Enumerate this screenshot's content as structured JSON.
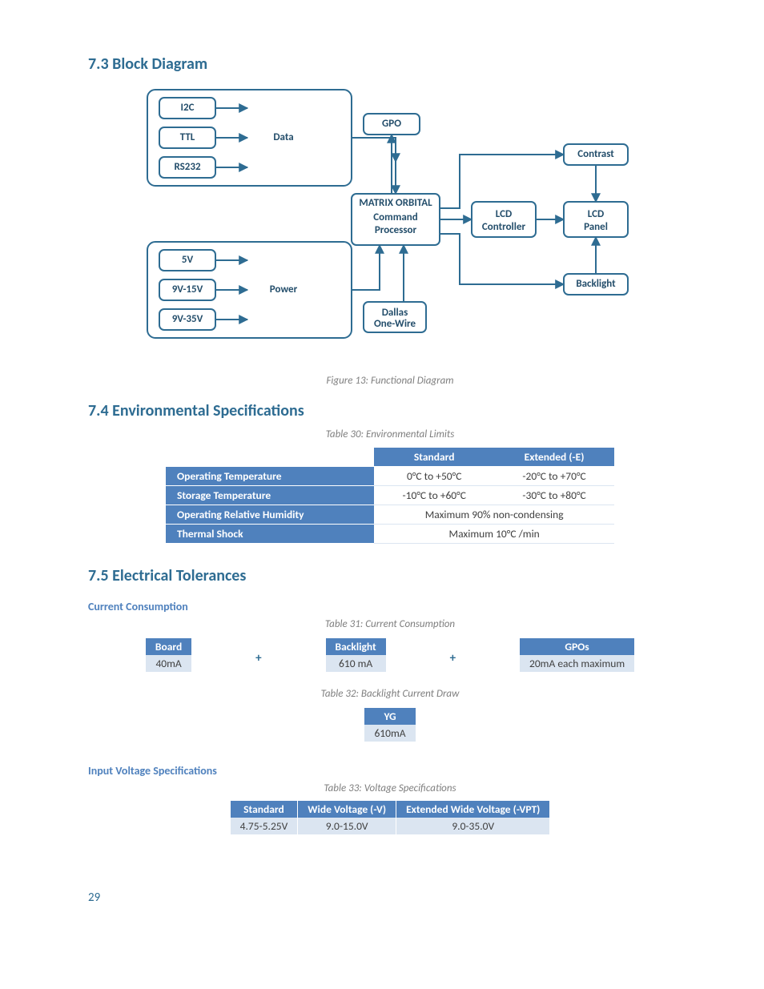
{
  "sections": {
    "block_diagram_heading": "7.3 Block Diagram",
    "env_heading": "7.4 Environmental Specifications",
    "elec_heading": "7.5 Electrical Tolerances",
    "cc_sub": "Current Consumption",
    "iv_sub": "Input Voltage Specifications"
  },
  "captions": {
    "fig13": "Figure 13: Functional Diagram",
    "table30": "Table 30: Environmental Limits",
    "table31": "Table 31: Current Consumption",
    "table32": "Table 32: Backlight Current Draw",
    "table33": "Table 33: Voltage Specifications"
  },
  "diagram": {
    "i2c": "I2C",
    "ttl": "TTL",
    "rs232": "RS232",
    "data_label": "Data",
    "gpo": "GPO",
    "proc_brand": "MATRIX ORBITAL",
    "proc_l1": "Command",
    "proc_l2": "Processor",
    "lcd_ctrl_l1": "LCD",
    "lcd_ctrl_l2": "Controller",
    "lcd_panel_l1": "LCD",
    "lcd_panel_l2": "Panel",
    "contrast": "Contrast",
    "backlight": "Backlight",
    "v5": "5V",
    "v9_15": "9V-15V",
    "v9_35": "9V-35V",
    "power_label": "Power",
    "dallas_l1": "Dallas",
    "dallas_l2": "One-Wire"
  },
  "env_table": {
    "col_standard": "Standard",
    "col_extended": "Extended (-E)",
    "rows": [
      {
        "label": "Operating Temperature",
        "standard": "0°C to +50°C",
        "extended": "-20°C to +70°C"
      },
      {
        "label": "Storage Temperature",
        "standard": "-10°C to +60°C",
        "extended": "-30°C to +80°C"
      },
      {
        "label": "Operating Relative Humidity",
        "merged": "Maximum 90% non-condensing"
      },
      {
        "label": "Thermal Shock",
        "merged": "Maximum 10°C /min"
      }
    ]
  },
  "cc_table": {
    "board_h": "Board",
    "board_v": "40mA",
    "backlight_h": "Backlight",
    "backlight_v": "610 mA",
    "gpos_h": "GPOs",
    "gpos_v": "20mA each maximum"
  },
  "bl_table": {
    "h": "YG",
    "v": "610mA"
  },
  "volt_table": {
    "h1": "Standard",
    "h2": "Wide Voltage (-V)",
    "h3": "Extended Wide Voltage (-VPT)",
    "v1": "4.75-5.25V",
    "v2": "9.0-15.0V",
    "v3": "9.0-35.0V"
  },
  "page_number": "29"
}
